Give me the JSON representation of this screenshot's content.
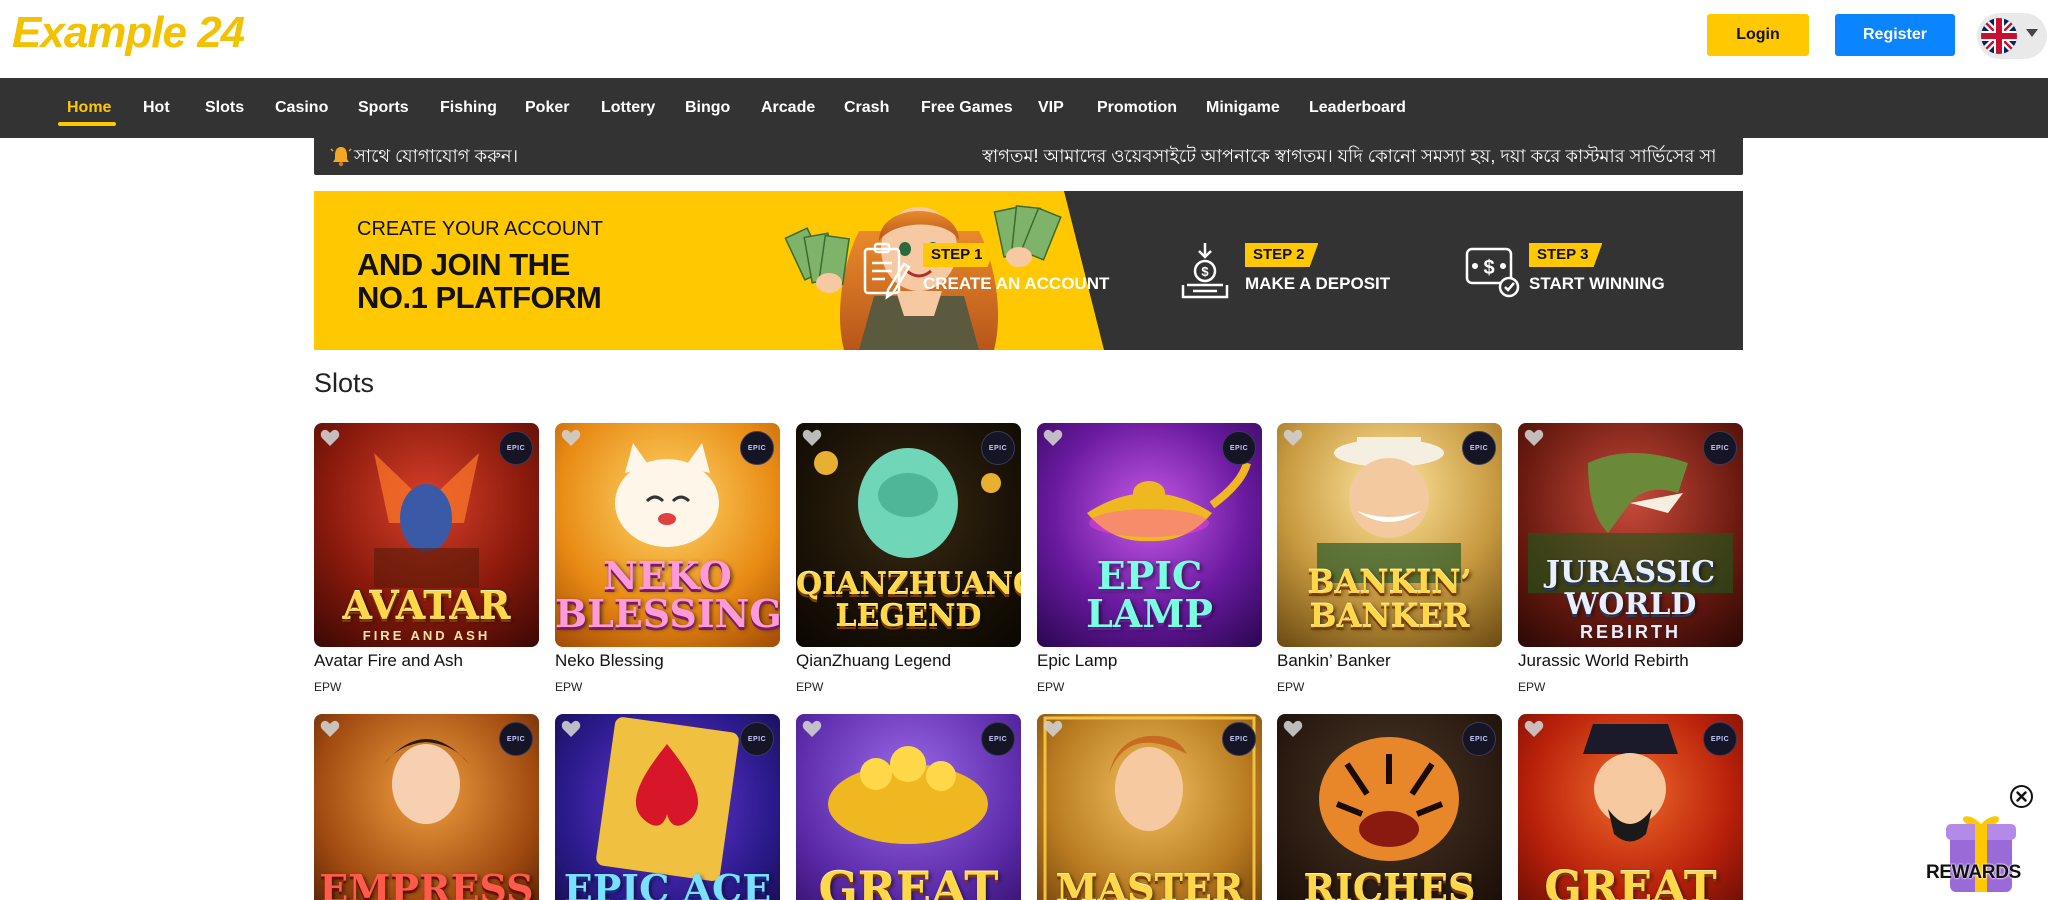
{
  "header": {
    "logo": "Example 24",
    "login_label": "Login",
    "register_label": "Register",
    "language_icon": "uk-flag-icon"
  },
  "nav": {
    "items": [
      "Home",
      "Hot",
      "Slots",
      "Casino",
      "Sports",
      "Fishing",
      "Poker",
      "Lottery",
      "Bingo",
      "Arcade",
      "Crash",
      "Free Games",
      "VIP",
      "Promotion",
      "Minigame",
      "Leaderboard"
    ],
    "active": "Home"
  },
  "marquee": {
    "icon": "bell-icon",
    "text_left": "সাথে যোগাযোগ করুন।",
    "text_right": "স্বাগতম! আমাদের ওয়েবসাইটে আপনাকে স্বাগতম। যদি কোনো সমস্যা হয়, দয়া করে কাস্টমার সার্ভিসের সাথে"
  },
  "banner": {
    "line1": "CREATE YOUR ACCOUNT",
    "line2": "AND JOIN THE",
    "line3": "NO.1 PLATFORM",
    "steps": [
      {
        "badge": "STEP 1",
        "label": "CREATE AN ACCOUNT",
        "icon": "clipboard-pen-icon"
      },
      {
        "badge": "STEP 2",
        "label": "MAKE A DEPOSIT",
        "icon": "coin-deposit-icon"
      },
      {
        "badge": "STEP 3",
        "label": "START WINNING",
        "icon": "dollar-screen-icon"
      }
    ]
  },
  "slots": {
    "title": "Slots",
    "games_row1": [
      {
        "name": "Avatar Fire and Ash",
        "provider": "EPW",
        "art_title": "AVATAR",
        "art_sub": "FIRE AND ASH"
      },
      {
        "name": "Neko Blessing",
        "provider": "EPW",
        "art_title": "NEKO BLESSING",
        "art_sub": ""
      },
      {
        "name": "QianZhuang Legend",
        "provider": "EPW",
        "art_title": "QIANZHUANG LEGEND",
        "art_sub": ""
      },
      {
        "name": "Epic Lamp",
        "provider": "EPW",
        "art_title": "EPIC LAMP",
        "art_sub": ""
      },
      {
        "name": "Bankin’ Banker",
        "provider": "EPW",
        "art_title": "BANKIN’ BANKER",
        "art_sub": ""
      },
      {
        "name": "Jurassic World Rebirth",
        "provider": "EPW",
        "art_title": "JURASSIC WORLD",
        "art_sub": "REBIRTH"
      }
    ],
    "games_row2_art": [
      "EMPRESS",
      "EPIC ACE",
      "GREAT",
      "MASTER",
      "RICHES",
      "GREAT"
    ],
    "provider_badge": "EPIC"
  },
  "rewards": {
    "label": "REWARDS"
  },
  "colors": {
    "accent": "#ffc800",
    "register": "#0a84ff",
    "nav_bg": "#333333"
  }
}
